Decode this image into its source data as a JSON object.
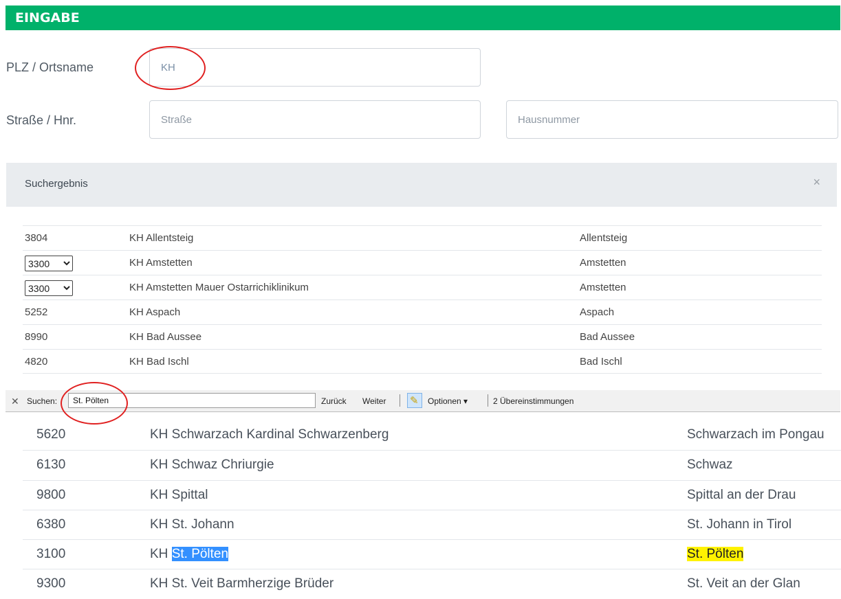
{
  "header": {
    "title": "EINGABE"
  },
  "form": {
    "plz_label": "PLZ / Ortsname",
    "plz_value": "KH",
    "strasse_label": "Straße / Hnr.",
    "strasse_placeholder": "Straße",
    "hausnummer_placeholder": "Hausnummer"
  },
  "results": {
    "title": "Suchergebnis",
    "close_icon": "close-icon",
    "rows": [
      {
        "plz": "3804",
        "name": "KH Allentsteig",
        "ort": "Allentsteig"
      },
      {
        "plz": "3300",
        "name": "KH Amstetten",
        "ort": "Amstetten"
      },
      {
        "plz": "3300",
        "name": "KH Amstetten Mauer Ostarrichiklinikum",
        "ort": "Amstetten"
      },
      {
        "plz": "5252",
        "name": "KH Aspach",
        "ort": "Aspach"
      },
      {
        "plz": "8990",
        "name": "KH Bad Aussee",
        "ort": "Bad Aussee"
      },
      {
        "plz": "4820",
        "name": "KH Bad Ischl",
        "ort": "Bad Ischl"
      }
    ]
  },
  "findbar": {
    "label": "Suchen:",
    "query": "St. Pölten",
    "back": "Zurück",
    "next": "Weiter",
    "options": "Optionen",
    "matches": "2 Übereinstimmungen"
  },
  "zoomed_rows": [
    {
      "plz": "5620",
      "name": "KH Schwarzach Kardinal Schwarzenberg",
      "ort": "Schwarzach im Pongau"
    },
    {
      "plz": "6130",
      "name": "KH Schwaz Chriurgie",
      "ort": "Schwaz"
    },
    {
      "plz": "9800",
      "name": "KH Spittal",
      "ort": "Spittal an der Drau"
    },
    {
      "plz": "6380",
      "name": "KH St. Johann",
      "ort": "St. Johann in Tirol"
    },
    {
      "plz": "3100",
      "name_prefix": "KH ",
      "name_match": "St. Pölten",
      "ort": "St. Pölten"
    },
    {
      "plz": "9300",
      "name": "KH St. Veit Barmherzige Brüder",
      "ort": "St. Veit an der Glan"
    }
  ],
  "colors": {
    "header_bg": "#00b16a",
    "annotation": "#e02020",
    "selection": "#3390ff",
    "highlight": "#fff200"
  }
}
